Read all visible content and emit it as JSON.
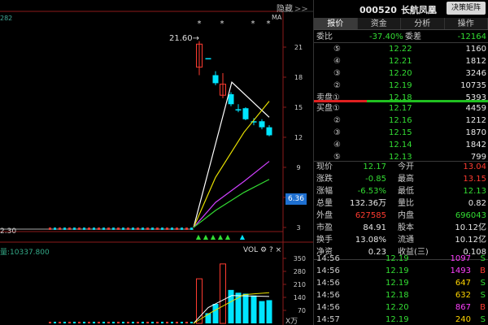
{
  "chart": {
    "hide_label": "隐藏",
    "hide_chevron": ">>",
    "corner_code": "282",
    "ma_label": "MA",
    "high_price_label": "21.60",
    "low_price_label": "2.30",
    "current_price_tag": "6.36",
    "vol_text": "10337.800",
    "vol_tag": "VOL",
    "vol_gear": "⚙",
    "vol_help": "?",
    "vol_close": "×",
    "y_ticks": [
      "21",
      "18",
      "15",
      "12",
      "9",
      "6",
      "3"
    ],
    "vol_ticks": [
      "350",
      "280",
      "210",
      "140",
      "70"
    ],
    "vol_unit": "X万",
    "colors": {
      "up": "#ff3b30",
      "down": "#00e5ff",
      "ma1": "#ffffff",
      "ma2": "#e8e000",
      "ma3": "#d040ff",
      "ma4": "#33dd33"
    }
  },
  "header": {
    "code": "000520",
    "name": "长航凤凰",
    "decision_button": "决策矩阵"
  },
  "tabs": [
    "报价",
    "资金",
    "分析",
    "操作"
  ],
  "ratio": {
    "label1": "委比",
    "value1": "-37.40%",
    "label2": "委差",
    "value2": "-12164"
  },
  "sell_orders": [
    {
      "level": "⑤",
      "price": "12.22",
      "volume": "1160"
    },
    {
      "level": "④",
      "price": "12.21",
      "volume": "1812"
    },
    {
      "level": "③",
      "price": "12.20",
      "volume": "3246"
    },
    {
      "level": "②",
      "price": "12.19",
      "volume": "10735"
    },
    {
      "level": "卖盘①",
      "price": "12.18",
      "volume": "5393"
    }
  ],
  "buy_orders": [
    {
      "level": "买盘①",
      "price": "12.17",
      "volume": "4459"
    },
    {
      "level": "②",
      "price": "12.16",
      "volume": "1212"
    },
    {
      "level": "③",
      "price": "12.15",
      "volume": "1870"
    },
    {
      "level": "④",
      "price": "12.14",
      "volume": "1842"
    },
    {
      "level": "⑤",
      "price": "12.13",
      "volume": "799"
    }
  ],
  "quote": [
    {
      "l1": "现价",
      "v1": "12.17",
      "c1": "green",
      "l2": "今开",
      "v2": "13.04",
      "c2": "red"
    },
    {
      "l1": "涨跌",
      "v1": "-0.85",
      "c1": "green",
      "l2": "最高",
      "v2": "13.15",
      "c2": "red"
    },
    {
      "l1": "涨幅",
      "v1": "-6.53%",
      "c1": "green",
      "l2": "最低",
      "v2": "12.13",
      "c2": "green"
    },
    {
      "l1": "总量",
      "v1": "132.36万",
      "c1": "white",
      "l2": "量比",
      "v2": "0.82",
      "c2": "white"
    },
    {
      "l1": "外盘",
      "v1": "627585",
      "c1": "red",
      "l2": "内盘",
      "v2": "696043",
      "c2": "green"
    },
    {
      "l1": "市盈",
      "v1": "84.91",
      "c1": "white",
      "l2": "股本",
      "v2": "10.12亿",
      "c2": "white"
    },
    {
      "l1": "换手",
      "v1": "13.08%",
      "c1": "white",
      "l2": "流通",
      "v2": "10.12亿",
      "c2": "white"
    },
    {
      "l1": "净资",
      "v1": "0.23",
      "c1": "white",
      "l2": "收益(三)",
      "v2": "0.108",
      "c2": "white"
    }
  ],
  "trades": [
    {
      "time": "14:56",
      "price": "12.19",
      "volume": "1097",
      "side": "S",
      "vcolor": "magenta",
      "scolor": "green"
    },
    {
      "time": "14:56",
      "price": "12.19",
      "volume": "1493",
      "side": "B",
      "vcolor": "magenta",
      "scolor": "red"
    },
    {
      "time": "14:56",
      "price": "12.19",
      "volume": "647",
      "side": "S",
      "vcolor": "yellow",
      "scolor": "green"
    },
    {
      "time": "14:56",
      "price": "12.18",
      "volume": "632",
      "side": "S",
      "vcolor": "yellow",
      "scolor": "green"
    },
    {
      "time": "14:56",
      "price": "12.20",
      "volume": "867",
      "side": "B",
      "vcolor": "magenta",
      "scolor": "red"
    },
    {
      "time": "14:57",
      "price": "12.19",
      "volume": "240",
      "side": "S",
      "vcolor": "yellow",
      "scolor": "green"
    }
  ]
}
